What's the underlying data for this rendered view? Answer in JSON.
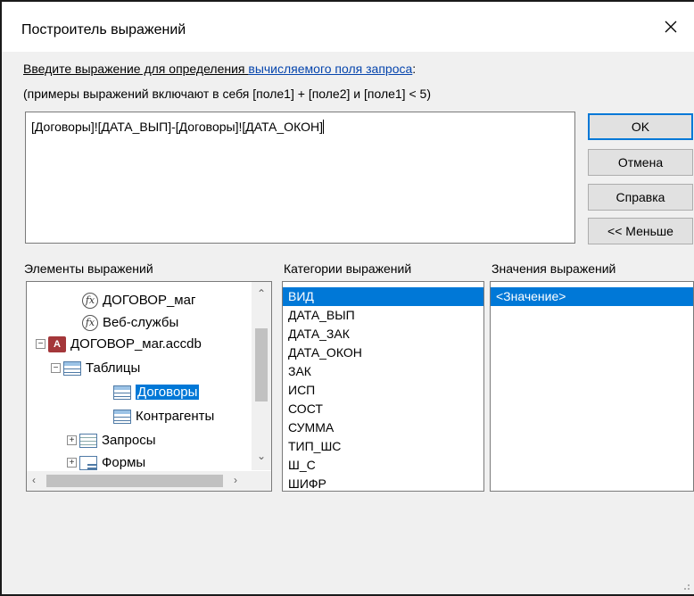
{
  "window": {
    "title": "Построитель выражений",
    "close_icon": "close-icon"
  },
  "instructions": {
    "line1_prefix": "Введите выражение для определения ",
    "line1_link": "вычисляемого поля запроса",
    "line1_suffix": ":",
    "line2": "(примеры выражений включают в себя [поле1] + [поле2] и [поле1] < 5)"
  },
  "expression": {
    "value": "[Договоры]![ДАТА_ВЫП]-[Договоры]![ДАТА_ОКОН]"
  },
  "buttons": {
    "ok": "OK",
    "cancel": "Отмена",
    "help": "Справка",
    "less": "<< Меньше"
  },
  "labels": {
    "elements": "Элементы выражений",
    "categories": "Категории выражений",
    "values": "Значения выражений"
  },
  "tree": {
    "items": [
      {
        "label": "ДОГОВОР_маг",
        "icon": "function-icon"
      },
      {
        "label": "Веб-службы",
        "icon": "function-icon"
      },
      {
        "label": "ДОГОВОР_маг.accdb",
        "icon": "access-database-icon",
        "expander": "−"
      },
      {
        "label": "Таблицы",
        "icon": "table-icon",
        "expander": "−"
      },
      {
        "label": "Договоры",
        "icon": "table-icon"
      },
      {
        "label": "Контрагенты",
        "icon": "table-icon"
      },
      {
        "label": "Запросы",
        "icon": "query-icon",
        "expander": "+"
      },
      {
        "label": "Формы",
        "icon": "form-icon",
        "expander": "+"
      }
    ]
  },
  "categories": [
    "ВИД",
    "ДАТА_ВЫП",
    "ДАТА_ЗАК",
    "ДАТА_ОКОН",
    "ЗАК",
    "ИСП",
    "СОСТ",
    "СУММА",
    "ТИП_ШС",
    "Ш_С",
    "ШИФР"
  ],
  "values": [
    "<Значение>"
  ],
  "colors": {
    "selection": "#0078d7",
    "link": "#0645ad",
    "dialog_bg": "#f0f0f0"
  }
}
